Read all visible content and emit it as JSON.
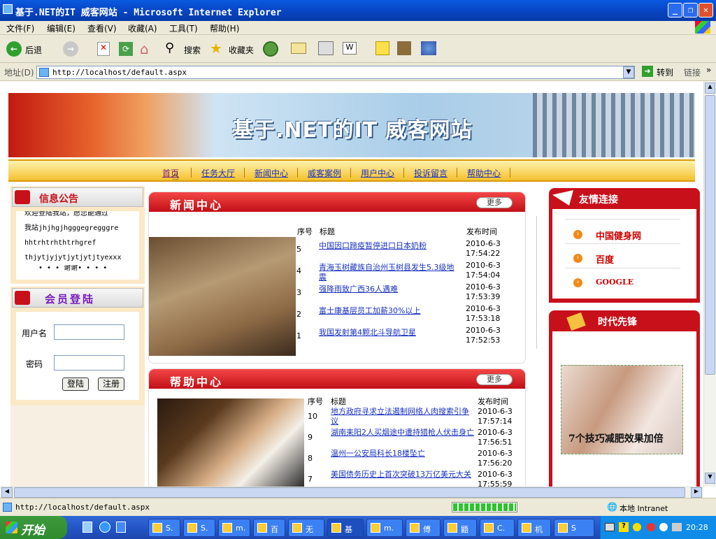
{
  "window": {
    "title": "基于.NET的IT 威客网站 - Microsoft Internet Explorer"
  },
  "menu": [
    "文件(F)",
    "编辑(E)",
    "查看(V)",
    "收藏(A)",
    "工具(T)",
    "帮助(H)"
  ],
  "toolbar": {
    "back": "后退",
    "search": "搜索",
    "favorites": "收藏夹"
  },
  "address": {
    "label": "地址(D)",
    "url": "http://localhost/default.aspx",
    "go": "转到",
    "links": "链接"
  },
  "page": {
    "banner_title": "基于.NET的IT 威客网站",
    "nav": [
      "首页",
      "任务大厅",
      "新闻中心",
      "威客案例",
      "用户中心",
      "投诉留言",
      "帮助中心"
    ],
    "notice": {
      "title": "信息公告",
      "lines": [
        "欢迎登陆我站，愿您能通过",
        "我站jhjhgjhgggegregggre",
        "hhtrhtrhthtrhgref",
        "thjytjyjytjytjytjtyexxx",
        "• • • 谢谢• • • •"
      ]
    },
    "login": {
      "title": "会员登陆",
      "username_label": "用户名",
      "password_label": "密码",
      "login_btn": "登陆",
      "register_btn": "注册"
    },
    "news": {
      "title": "新闻中心",
      "more": "更多",
      "headers": [
        "序号",
        "标题",
        "发布时间"
      ],
      "rows": [
        {
          "no": "5",
          "title": "中国因口蹄疫暂停进口日本奶粉",
          "date": "2010-6-3",
          "time": "17:54:22"
        },
        {
          "no": "4",
          "title": "青海玉树藏族自治州玉树县发生5.3级地震",
          "date": "2010-6-3",
          "time": "17:54:04"
        },
        {
          "no": "3",
          "title": "强降雨致广西36人遇难",
          "date": "2010-6-3",
          "time": "17:53:39"
        },
        {
          "no": "2",
          "title": "富士康基层员工加薪30%以上",
          "date": "2010-6-3",
          "time": "17:53:18"
        },
        {
          "no": "1",
          "title": "我国发射第4颗北斗导航卫星",
          "date": "2010-6-3",
          "time": "17:52:53"
        }
      ]
    },
    "help": {
      "title": "帮助中心",
      "more": "更多",
      "headers": [
        "序号",
        "标题",
        "发布时间"
      ],
      "rows": [
        {
          "no": "10",
          "title": "地方政府寻求立法遏制网络人肉搜索引争议",
          "date": "2010-6-3",
          "time": "17:57:14"
        },
        {
          "no": "9",
          "title": "湖南耒阳2人买烟途中遭持猎枪人伏击身亡",
          "date": "2010-6-3",
          "time": "17:56:51"
        },
        {
          "no": "8",
          "title": "温州一公安局科长18楼坠亡",
          "date": "2010-6-3",
          "time": "17:56:20"
        },
        {
          "no": "7",
          "title": "美国债务历史上首次突破13万亿美元大关",
          "date": "2010-6-3",
          "time": "17:55:59"
        }
      ]
    },
    "friends": {
      "title": "友情连接",
      "links": [
        "中国健身网",
        "百度",
        "GOOGLE"
      ]
    },
    "pioneer": {
      "title": "时代先锋",
      "ad_text": "7个技巧减肥效果加倍"
    }
  },
  "status": {
    "url": "http://localhost/default.aspx",
    "zone": "本地 Intranet"
  },
  "taskbar": {
    "start": "开始",
    "tasks": [
      "S.",
      "S.",
      "m.",
      "百",
      "无",
      "基",
      "m.",
      "傅",
      "鼯",
      "C.",
      "机",
      "S"
    ],
    "clock": "20:28"
  }
}
